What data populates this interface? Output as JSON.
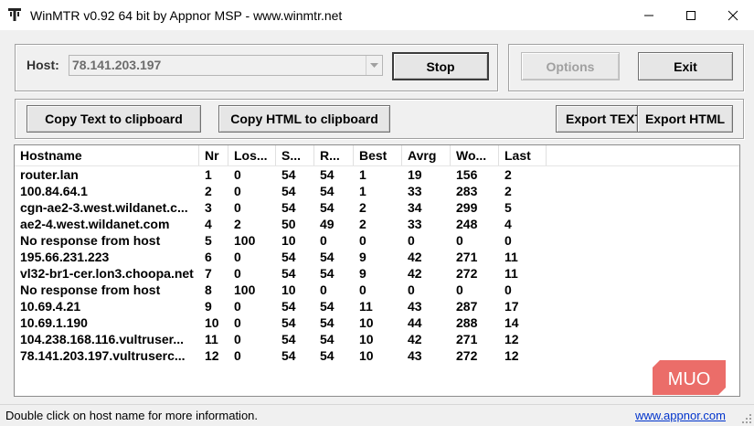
{
  "window": {
    "title": "WinMTR v0.92 64 bit by Appnor MSP - www.winmtr.net",
    "app_icon": "winmtr-app-icon",
    "controls": [
      "minimize-icon",
      "maximize-icon",
      "close-icon"
    ]
  },
  "host_group": {
    "label": "Host:",
    "host_value": "78.141.203.197",
    "stop_label": "Stop"
  },
  "actions": {
    "options_label": "Options",
    "exit_label": "Exit",
    "copy_text_label": "Copy Text to clipboard",
    "copy_html_label": "Copy HTML to clipboard",
    "export_text_label": "Export TEXT",
    "export_html_label": "Export HTML"
  },
  "table": {
    "columns": [
      "Hostname",
      "Nr",
      "Loss %",
      "Sent",
      "Recv",
      "Best",
      "Avrg",
      "Worst",
      "Last"
    ],
    "visible_columns": [
      "Hostname",
      "Nr",
      "Los...",
      "S...",
      "R...",
      "Best",
      "Avrg",
      "Wo...",
      "Last"
    ],
    "rows": [
      [
        "router.lan",
        "1",
        "0",
        "54",
        "54",
        "1",
        "19",
        "156",
        "2"
      ],
      [
        "100.84.64.1",
        "2",
        "0",
        "54",
        "54",
        "1",
        "33",
        "283",
        "2"
      ],
      [
        "cgn-ae2-3.west.wildanet.c...",
        "3",
        "0",
        "54",
        "54",
        "2",
        "34",
        "299",
        "5"
      ],
      [
        "ae2-4.west.wildanet.com",
        "4",
        "2",
        "50",
        "49",
        "2",
        "33",
        "248",
        "4"
      ],
      [
        "No response from host",
        "5",
        "100",
        "10",
        "0",
        "0",
        "0",
        "0",
        "0"
      ],
      [
        "195.66.231.223",
        "6",
        "0",
        "54",
        "54",
        "9",
        "42",
        "271",
        "11"
      ],
      [
        "vl32-br1-cer.lon3.choopa.net",
        "7",
        "0",
        "54",
        "54",
        "9",
        "42",
        "272",
        "11"
      ],
      [
        "No response from host",
        "8",
        "100",
        "10",
        "0",
        "0",
        "0",
        "0",
        "0"
      ],
      [
        "10.69.4.21",
        "9",
        "0",
        "54",
        "54",
        "11",
        "43",
        "287",
        "17"
      ],
      [
        "10.69.1.190",
        "10",
        "0",
        "54",
        "54",
        "10",
        "44",
        "288",
        "14"
      ],
      [
        "104.238.168.116.vultruser...",
        "11",
        "0",
        "54",
        "54",
        "10",
        "42",
        "271",
        "12"
      ],
      [
        "78.141.203.197.vultruserc...",
        "12",
        "0",
        "54",
        "54",
        "10",
        "43",
        "272",
        "12"
      ]
    ]
  },
  "status": {
    "message": "Double click on host name for more information.",
    "link": "www.appnor.com"
  },
  "watermark": {
    "text": "MUO",
    "color": "#e8534f"
  }
}
